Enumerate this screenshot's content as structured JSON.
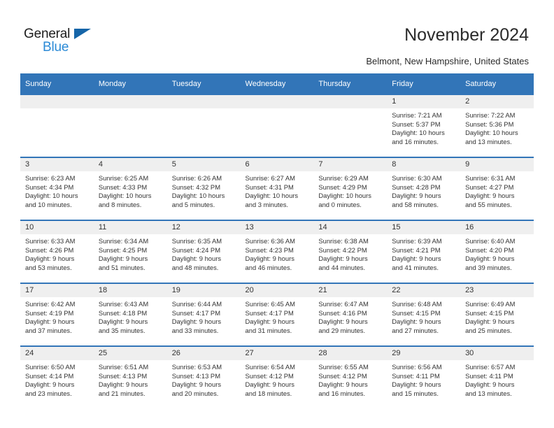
{
  "logo": {
    "word1": "General",
    "word2": "Blue",
    "triangle_color": "#1565a8",
    "word2_color": "#2b8ad6"
  },
  "header": {
    "title": "November 2024",
    "subtitle": "Belmont, New Hampshire, United States",
    "accent_color": "#3275b8",
    "daynum_band_color": "#efefef"
  },
  "calendar": {
    "weekday_headers": [
      "Sunday",
      "Monday",
      "Tuesday",
      "Wednesday",
      "Thursday",
      "Friday",
      "Saturday"
    ],
    "weeks": [
      [
        {
          "day": "",
          "lines": []
        },
        {
          "day": "",
          "lines": []
        },
        {
          "day": "",
          "lines": []
        },
        {
          "day": "",
          "lines": []
        },
        {
          "day": "",
          "lines": []
        },
        {
          "day": "1",
          "lines": [
            "Sunrise: 7:21 AM",
            "Sunset: 5:37 PM",
            "Daylight: 10 hours",
            "and 16 minutes."
          ]
        },
        {
          "day": "2",
          "lines": [
            "Sunrise: 7:22 AM",
            "Sunset: 5:36 PM",
            "Daylight: 10 hours",
            "and 13 minutes."
          ]
        }
      ],
      [
        {
          "day": "3",
          "lines": [
            "Sunrise: 6:23 AM",
            "Sunset: 4:34 PM",
            "Daylight: 10 hours",
            "and 10 minutes."
          ]
        },
        {
          "day": "4",
          "lines": [
            "Sunrise: 6:25 AM",
            "Sunset: 4:33 PM",
            "Daylight: 10 hours",
            "and 8 minutes."
          ]
        },
        {
          "day": "5",
          "lines": [
            "Sunrise: 6:26 AM",
            "Sunset: 4:32 PM",
            "Daylight: 10 hours",
            "and 5 minutes."
          ]
        },
        {
          "day": "6",
          "lines": [
            "Sunrise: 6:27 AM",
            "Sunset: 4:31 PM",
            "Daylight: 10 hours",
            "and 3 minutes."
          ]
        },
        {
          "day": "7",
          "lines": [
            "Sunrise: 6:29 AM",
            "Sunset: 4:29 PM",
            "Daylight: 10 hours",
            "and 0 minutes."
          ]
        },
        {
          "day": "8",
          "lines": [
            "Sunrise: 6:30 AM",
            "Sunset: 4:28 PM",
            "Daylight: 9 hours",
            "and 58 minutes."
          ]
        },
        {
          "day": "9",
          "lines": [
            "Sunrise: 6:31 AM",
            "Sunset: 4:27 PM",
            "Daylight: 9 hours",
            "and 55 minutes."
          ]
        }
      ],
      [
        {
          "day": "10",
          "lines": [
            "Sunrise: 6:33 AM",
            "Sunset: 4:26 PM",
            "Daylight: 9 hours",
            "and 53 minutes."
          ]
        },
        {
          "day": "11",
          "lines": [
            "Sunrise: 6:34 AM",
            "Sunset: 4:25 PM",
            "Daylight: 9 hours",
            "and 51 minutes."
          ]
        },
        {
          "day": "12",
          "lines": [
            "Sunrise: 6:35 AM",
            "Sunset: 4:24 PM",
            "Daylight: 9 hours",
            "and 48 minutes."
          ]
        },
        {
          "day": "13",
          "lines": [
            "Sunrise: 6:36 AM",
            "Sunset: 4:23 PM",
            "Daylight: 9 hours",
            "and 46 minutes."
          ]
        },
        {
          "day": "14",
          "lines": [
            "Sunrise: 6:38 AM",
            "Sunset: 4:22 PM",
            "Daylight: 9 hours",
            "and 44 minutes."
          ]
        },
        {
          "day": "15",
          "lines": [
            "Sunrise: 6:39 AM",
            "Sunset: 4:21 PM",
            "Daylight: 9 hours",
            "and 41 minutes."
          ]
        },
        {
          "day": "16",
          "lines": [
            "Sunrise: 6:40 AM",
            "Sunset: 4:20 PM",
            "Daylight: 9 hours",
            "and 39 minutes."
          ]
        }
      ],
      [
        {
          "day": "17",
          "lines": [
            "Sunrise: 6:42 AM",
            "Sunset: 4:19 PM",
            "Daylight: 9 hours",
            "and 37 minutes."
          ]
        },
        {
          "day": "18",
          "lines": [
            "Sunrise: 6:43 AM",
            "Sunset: 4:18 PM",
            "Daylight: 9 hours",
            "and 35 minutes."
          ]
        },
        {
          "day": "19",
          "lines": [
            "Sunrise: 6:44 AM",
            "Sunset: 4:17 PM",
            "Daylight: 9 hours",
            "and 33 minutes."
          ]
        },
        {
          "day": "20",
          "lines": [
            "Sunrise: 6:45 AM",
            "Sunset: 4:17 PM",
            "Daylight: 9 hours",
            "and 31 minutes."
          ]
        },
        {
          "day": "21",
          "lines": [
            "Sunrise: 6:47 AM",
            "Sunset: 4:16 PM",
            "Daylight: 9 hours",
            "and 29 minutes."
          ]
        },
        {
          "day": "22",
          "lines": [
            "Sunrise: 6:48 AM",
            "Sunset: 4:15 PM",
            "Daylight: 9 hours",
            "and 27 minutes."
          ]
        },
        {
          "day": "23",
          "lines": [
            "Sunrise: 6:49 AM",
            "Sunset: 4:15 PM",
            "Daylight: 9 hours",
            "and 25 minutes."
          ]
        }
      ],
      [
        {
          "day": "24",
          "lines": [
            "Sunrise: 6:50 AM",
            "Sunset: 4:14 PM",
            "Daylight: 9 hours",
            "and 23 minutes."
          ]
        },
        {
          "day": "25",
          "lines": [
            "Sunrise: 6:51 AM",
            "Sunset: 4:13 PM",
            "Daylight: 9 hours",
            "and 21 minutes."
          ]
        },
        {
          "day": "26",
          "lines": [
            "Sunrise: 6:53 AM",
            "Sunset: 4:13 PM",
            "Daylight: 9 hours",
            "and 20 minutes."
          ]
        },
        {
          "day": "27",
          "lines": [
            "Sunrise: 6:54 AM",
            "Sunset: 4:12 PM",
            "Daylight: 9 hours",
            "and 18 minutes."
          ]
        },
        {
          "day": "28",
          "lines": [
            "Sunrise: 6:55 AM",
            "Sunset: 4:12 PM",
            "Daylight: 9 hours",
            "and 16 minutes."
          ]
        },
        {
          "day": "29",
          "lines": [
            "Sunrise: 6:56 AM",
            "Sunset: 4:11 PM",
            "Daylight: 9 hours",
            "and 15 minutes."
          ]
        },
        {
          "day": "30",
          "lines": [
            "Sunrise: 6:57 AM",
            "Sunset: 4:11 PM",
            "Daylight: 9 hours",
            "and 13 minutes."
          ]
        }
      ]
    ]
  }
}
